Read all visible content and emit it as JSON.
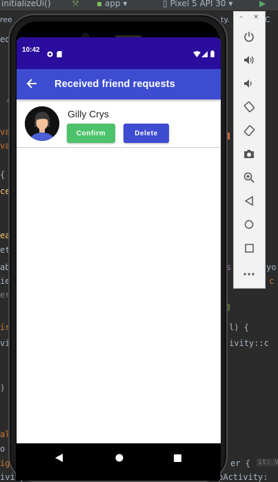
{
  "ide": {
    "toolbar_left": "initializeUi()",
    "run_config": "app",
    "device": "Pixel 5 API 30",
    "tab_left": "ree",
    "tab_mid": "ty.",
    "tab_right": "C",
    "code_fragments": {
      "a": "ed",
      "b": "A",
      "c": "va",
      "d": "va",
      "e": "{",
      "f": "ce",
      "g": "ea",
      "h": "et",
      "i": "ab",
      "j": "ie",
      "k": "er",
      "l": "ir",
      "m": "vi",
      "n": ")",
      "o": "al",
      "p": "o",
      "q": "ig",
      "r": "s",
      "s": "yo",
      "t": "M",
      "u": "c",
      "v": "l) {",
      "w": "ivity::c",
      "x": "er {",
      "y": "it: V",
      "z": "ivity(Intent(",
      "z2": "SignUpActivity:"
    }
  },
  "phone": {
    "status_time": "10:42",
    "app_bar_title": "Received friend requests",
    "requests": [
      {
        "name": "Gilly Crys",
        "confirm_label": "Confirm",
        "delete_label": "Delete"
      }
    ]
  },
  "emulator": {
    "minimize": "–",
    "close": "×",
    "buttons": [
      "power-icon",
      "volume-up-icon",
      "volume-down-icon",
      "rotate-left-icon",
      "rotate-right-icon",
      "camera-icon",
      "zoom-icon",
      "back-icon",
      "home-icon",
      "overview-icon",
      "more-icon"
    ]
  },
  "colors": {
    "status_bar": "#2a0d9c",
    "app_bar": "#3d4cd0",
    "confirm": "#4cc36a",
    "delete": "#3d4cd0"
  }
}
